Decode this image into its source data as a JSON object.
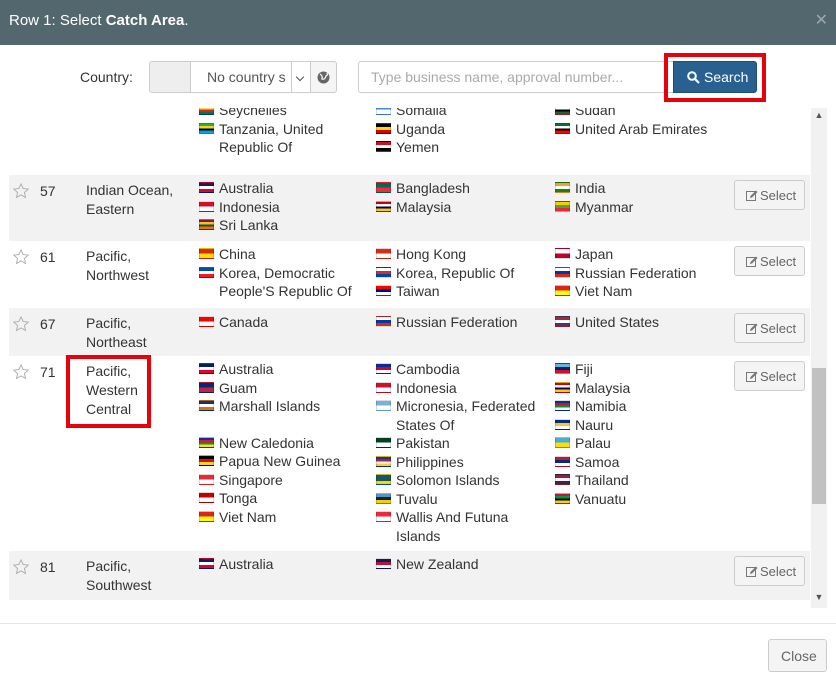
{
  "header": {
    "title_prefix": "Row 1: Select ",
    "title_bold": "Catch Area",
    "title_suffix": "."
  },
  "search": {
    "country_label": "Country:",
    "country_value": "No country s",
    "placeholder": "Type business name, approval number...",
    "button_label": "Search"
  },
  "rows": [
    {
      "num": "",
      "area": "",
      "col1": [
        [
          "Seychelles",
          "sc"
        ],
        [
          "Tanzania, United Republic Of",
          "tz"
        ]
      ],
      "col2": [
        [
          "Somalia",
          "so"
        ],
        [
          "Uganda",
          "ug"
        ],
        [
          "Yemen",
          "ye"
        ]
      ],
      "col3": [
        [
          "Sudan",
          "sd"
        ],
        [
          "United Arab Emirates",
          "ae"
        ]
      ],
      "select": ""
    },
    {
      "num": "57",
      "area": "Indian Ocean, Eastern",
      "col1": [
        [
          "Australia",
          "au"
        ],
        [
          "Indonesia",
          "id"
        ],
        [
          "Sri Lanka",
          "lk"
        ]
      ],
      "col2": [
        [
          "Bangladesh",
          "bd"
        ],
        [
          "Malaysia",
          "my"
        ]
      ],
      "col3": [
        [
          "India",
          "in"
        ],
        [
          "Myanmar",
          "mm"
        ]
      ],
      "select": "Select"
    },
    {
      "num": "61",
      "area": "Pacific, Northwest",
      "col1": [
        [
          "China",
          "cn"
        ],
        [
          "Korea, Democratic People'S Republic Of",
          "kp"
        ]
      ],
      "col2": [
        [
          "Hong Kong",
          "hk"
        ],
        [
          "Korea, Republic Of",
          "kr"
        ],
        [
          "Taiwan",
          "tw"
        ]
      ],
      "col3": [
        [
          "Japan",
          "jp"
        ],
        [
          "Russian Federation",
          "ru"
        ],
        [
          "Viet Nam",
          "vn"
        ]
      ],
      "select": "Select"
    },
    {
      "num": "67",
      "area": "Pacific, Northeast",
      "col1": [
        [
          "Canada",
          "ca"
        ]
      ],
      "col2": [
        [
          "Russian Federation",
          "ru"
        ]
      ],
      "col3": [
        [
          "United States",
          "us"
        ]
      ],
      "select": "Select"
    },
    {
      "num": "71",
      "area": "Pacific, Western Central",
      "col1": [
        [
          "Australia",
          "au"
        ],
        [
          "Guam",
          "gu"
        ],
        [
          "Marshall Islands",
          "mh"
        ],
        [
          "",
          ""
        ],
        [
          "New Caledonia",
          "nc"
        ],
        [
          "Papua New Guinea",
          "pg"
        ],
        [
          "Singapore",
          "sg"
        ],
        [
          "Tonga",
          "to"
        ],
        [
          "Viet Nam",
          "vn"
        ]
      ],
      "col2": [
        [
          "Cambodia",
          "kh"
        ],
        [
          "Indonesia",
          "id"
        ],
        [
          "Micronesia, Federated States Of",
          "fm"
        ],
        [
          "Pakistan",
          "pk"
        ],
        [
          "Philippines",
          "ph"
        ],
        [
          "Solomon Islands",
          "sb"
        ],
        [
          "Tuvalu",
          "tv"
        ],
        [
          "Wallis And Futuna Islands",
          "wf"
        ]
      ],
      "col3": [
        [
          "Fiji",
          "fj"
        ],
        [
          "Malaysia",
          "my"
        ],
        [
          "Namibia",
          "na"
        ],
        [
          "Nauru",
          "nr"
        ],
        [
          "Palau",
          "pw"
        ],
        [
          "Samoa",
          "ws"
        ],
        [
          "Thailand",
          "th"
        ],
        [
          "Vanuatu",
          "vu"
        ]
      ],
      "select": "Select"
    },
    {
      "num": "81",
      "area": "Pacific, Southwest",
      "col1": [
        [
          "Australia",
          "au"
        ]
      ],
      "col2": [
        [
          "New Zealand",
          "nz"
        ]
      ],
      "col3": [],
      "select": "Select"
    }
  ],
  "flag_colors": {
    "sc": [
      "#003f87",
      "#fcd856",
      "#d62828",
      "#007a3d"
    ],
    "tz": [
      "#1eb53a",
      "#fcd116",
      "#000",
      "#00a3dd"
    ],
    "so": [
      "#4189dd",
      "#fff"
    ],
    "ug": [
      "#000",
      "#fcdc04",
      "#d90000"
    ],
    "ye": [
      "#ce1126",
      "#fff",
      "#000"
    ],
    "sd": [
      "#d21034",
      "#fff",
      "#000",
      "#007229"
    ],
    "ae": [
      "#00732f",
      "#fff",
      "#000",
      "#ff0000"
    ],
    "au": [
      "#012169",
      "#fff",
      "#e4002b"
    ],
    "id": [
      "#ce1126",
      "#fff"
    ],
    "lk": [
      "#8d153a",
      "#ffbe29",
      "#00534e",
      "#eb7400"
    ],
    "bd": [
      "#006a4e",
      "#f42a41"
    ],
    "my": [
      "#cc0001",
      "#fff",
      "#010066",
      "#ffcc00"
    ],
    "in": [
      "#ff9933",
      "#fff",
      "#138808"
    ],
    "mm": [
      "#fecb00",
      "#34b233",
      "#ea2839"
    ],
    "cn": [
      "#de2910",
      "#ffde00"
    ],
    "kp": [
      "#024fa2",
      "#fff",
      "#ed1c27"
    ],
    "hk": [
      "#de2910",
      "#fff"
    ],
    "kr": [
      "#fff",
      "#cd2e3a",
      "#0047a0"
    ],
    "tw": [
      "#fe0000",
      "#000095",
      "#fff"
    ],
    "jp": [
      "#fff",
      "#bc002d"
    ],
    "ru": [
      "#fff",
      "#0039a6",
      "#d52b1e"
    ],
    "vn": [
      "#da251d",
      "#ffff00"
    ],
    "ca": [
      "#ff0000",
      "#fff"
    ],
    "us": [
      "#b22234",
      "#fff",
      "#3c3b6e"
    ],
    "gu": [
      "#00297b",
      "#c62139"
    ],
    "mh": [
      "#003893",
      "#fff",
      "#dd7500"
    ],
    "nc": [
      "#0035ad",
      "#e8112d",
      "#009543",
      "#fae600"
    ],
    "pg": [
      "#000",
      "#ce1126",
      "#fcd116"
    ],
    "sg": [
      "#ed2939",
      "#fff"
    ],
    "to": [
      "#c10000",
      "#fff"
    ],
    "kh": [
      "#032ea1",
      "#e00025",
      "#fff"
    ],
    "fm": [
      "#75b2dd",
      "#fff"
    ],
    "pk": [
      "#01411c",
      "#fff"
    ],
    "ph": [
      "#0038a8",
      "#ce1126",
      "#fff",
      "#fcd116"
    ],
    "sb": [
      "#0051ba",
      "#215b33",
      "#fcd116"
    ],
    "tv": [
      "#5b97b1",
      "#012169",
      "#ffce00"
    ],
    "wf": [
      "#ed2939",
      "#fff"
    ],
    "fj": [
      "#62b5e5",
      "#012169",
      "#ce1126"
    ],
    "na": [
      "#003580",
      "#d21034",
      "#009543",
      "#fff"
    ],
    "nr": [
      "#002b7f",
      "#ffc61e",
      "#fff"
    ],
    "pw": [
      "#4aadd6",
      "#ffde00"
    ],
    "ws": [
      "#ce1126",
      "#002b7f",
      "#fff"
    ],
    "th": [
      "#a51931",
      "#f4f5f8",
      "#2d2a4a"
    ],
    "vu": [
      "#d21034",
      "#009543",
      "#000",
      "#fdce12"
    ],
    "nz": [
      "#012169",
      "#c8102e",
      "#fff"
    ]
  },
  "footer": {
    "close_label": "Close"
  }
}
